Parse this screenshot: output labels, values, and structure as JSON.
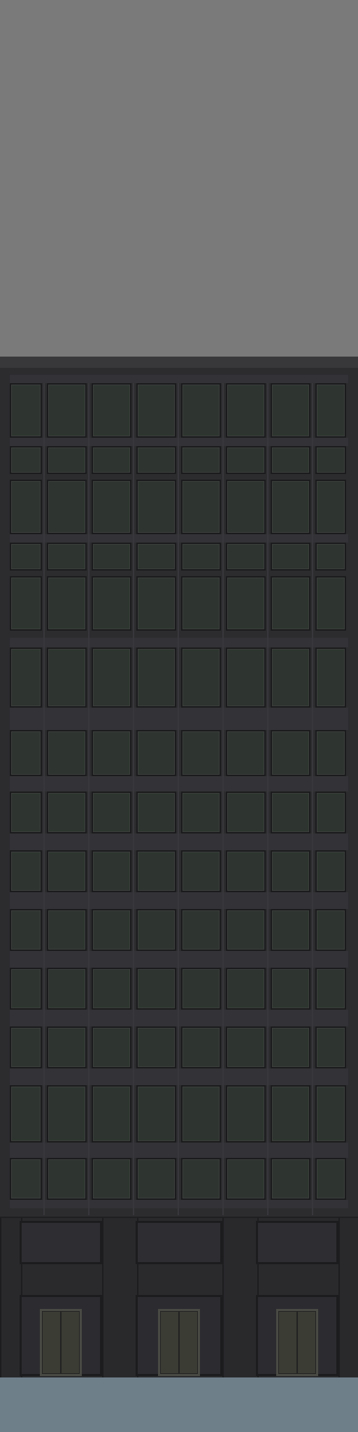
{
  "scene": {
    "colors": {
      "sky": "#7a7a7a",
      "facade": "#2c2c2f",
      "window_glass": "#2e3530",
      "door_glass": "#3b3c34",
      "street": "#6f7f8a"
    },
    "facade": {
      "columns": 8,
      "floors": 14
    },
    "entrance": {
      "doors": 3
    }
  }
}
